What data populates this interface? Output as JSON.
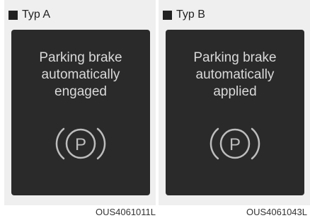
{
  "panels": [
    {
      "label": "Typ A",
      "lines": [
        "Parking brake",
        "automatically",
        "engaged"
      ],
      "code": "OUS4061011L"
    },
    {
      "label": "Typ B",
      "lines": [
        "Parking brake",
        "automatically",
        "applied"
      ],
      "code": "OUS4061043L"
    }
  ],
  "icons": {
    "indicator": "parking-brake-icon"
  },
  "colors": {
    "screen": "#2a2a2a",
    "text": "#d9d9d9",
    "panel": "#efefef"
  }
}
